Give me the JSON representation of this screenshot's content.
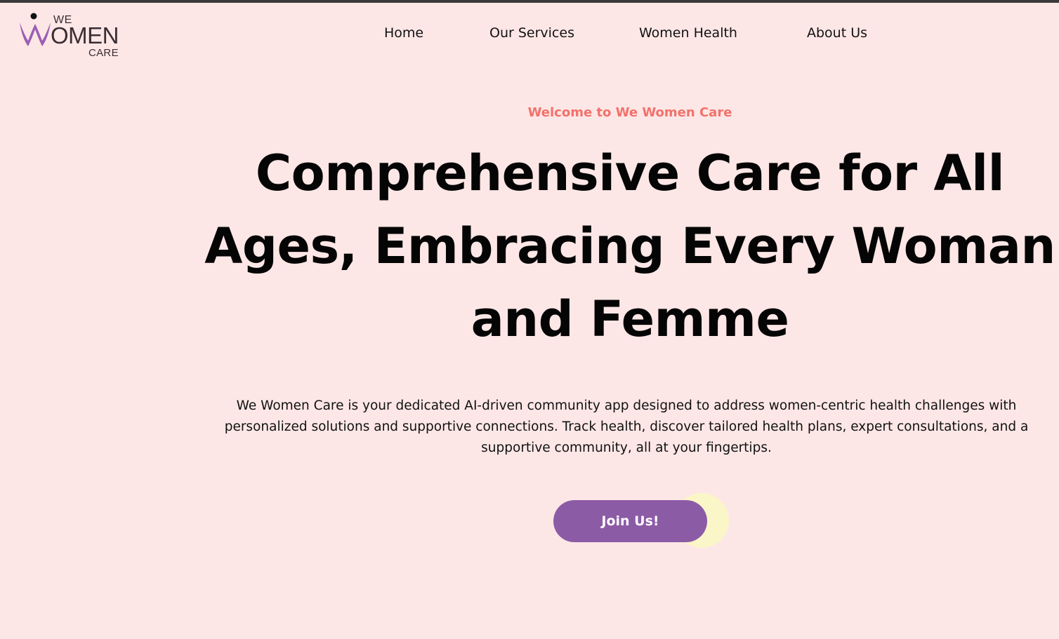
{
  "brand": {
    "logo_we": "WE",
    "logo_omen": "OMEN",
    "logo_care": "CARE",
    "logo_color": "#9b5fb4"
  },
  "nav": {
    "items": [
      {
        "label": "Home"
      },
      {
        "label": "Our Services"
      },
      {
        "label": "Women Health"
      },
      {
        "label": "About Us"
      }
    ]
  },
  "hero": {
    "eyebrow": "Welcome to We Women Care",
    "headline": "Comprehensive Care for All Ages, Embracing Every Woman and Femme",
    "description": "We Women Care is your dedicated AI-driven community app designed to address women-centric health challenges with personalized solutions and supportive connections. Track health, discover tailored health plans, expert consultations, and a supportive community, all at your fingertips.",
    "cta_label": "Join Us!"
  },
  "colors": {
    "background": "#fde7e6",
    "accent_coral": "#f2716b",
    "button_purple": "#8c5ba6",
    "button_glow": "#fbf6c8",
    "text": "#050505"
  }
}
